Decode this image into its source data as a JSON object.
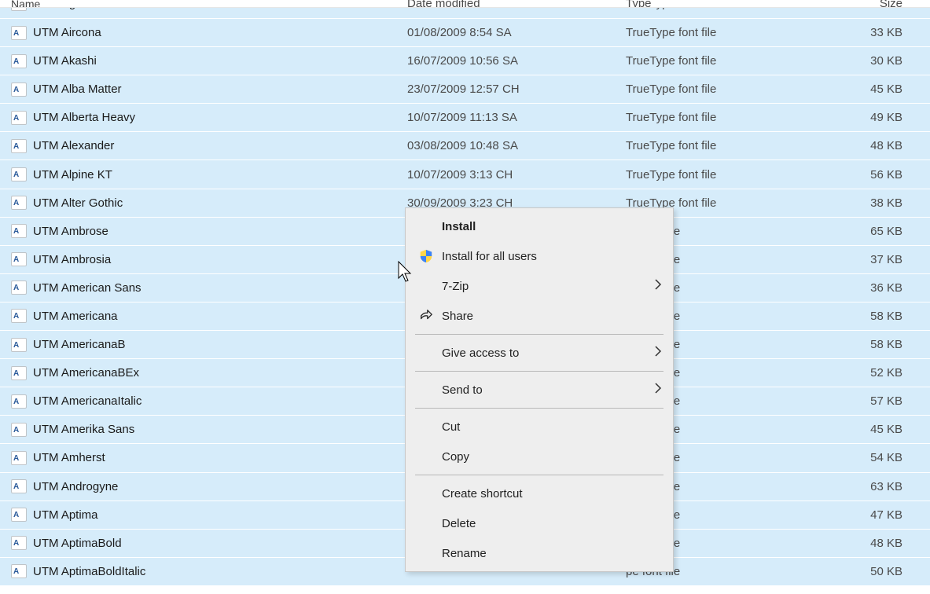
{
  "columns": {
    "name": "Name",
    "date": "Date modified",
    "type": "Type",
    "size": "Size"
  },
  "truetype": "TrueType font file",
  "pe_suffix": "pe font file",
  "files": [
    {
      "name": "UTM Agin",
      "date": "",
      "type_full": true,
      "size": ""
    },
    {
      "name": "UTM Aircona",
      "date": "01/08/2009 8:54 SA",
      "type_full": true,
      "size": "33 KB"
    },
    {
      "name": "UTM Akashi",
      "date": "16/07/2009 10:56 SA",
      "type_full": true,
      "size": "30 KB"
    },
    {
      "name": "UTM Alba Matter",
      "date": "23/07/2009 12:57 CH",
      "type_full": true,
      "size": "45 KB"
    },
    {
      "name": "UTM Alberta Heavy",
      "date": "10/07/2009 11:13 SA",
      "type_full": true,
      "size": "49 KB"
    },
    {
      "name": "UTM Alexander",
      "date": "03/08/2009 10:48 SA",
      "type_full": true,
      "size": "48 KB"
    },
    {
      "name": "UTM Alpine KT",
      "date": "10/07/2009 3:13 CH",
      "type_full": true,
      "size": "56 KB"
    },
    {
      "name": "UTM Alter Gothic",
      "date": "30/09/2009 3:23 CH",
      "type_full": true,
      "size": "38 KB",
      "date_cut": true,
      "type_cut": true
    },
    {
      "name": "UTM Ambrose",
      "date": "",
      "type_full": false,
      "size": "65 KB"
    },
    {
      "name": "UTM Ambrosia",
      "date": "",
      "type_full": false,
      "size": "37 KB"
    },
    {
      "name": "UTM American Sans",
      "date": "",
      "type_full": false,
      "size": "36 KB"
    },
    {
      "name": "UTM Americana",
      "date": "",
      "type_full": false,
      "size": "58 KB"
    },
    {
      "name": "UTM AmericanaB",
      "date": "",
      "type_full": false,
      "size": "58 KB"
    },
    {
      "name": "UTM AmericanaBEx",
      "date": "",
      "type_full": false,
      "size": "52 KB"
    },
    {
      "name": "UTM AmericanaItalic",
      "date": "",
      "type_full": false,
      "size": "57 KB"
    },
    {
      "name": "UTM Amerika Sans",
      "date": "",
      "type_full": false,
      "size": "45 KB"
    },
    {
      "name": "UTM Amherst",
      "date": "",
      "type_full": false,
      "size": "54 KB"
    },
    {
      "name": "UTM Androgyne",
      "date": "",
      "type_full": false,
      "size": "63 KB"
    },
    {
      "name": "UTM Aptima",
      "date": "",
      "type_full": false,
      "size": "47 KB"
    },
    {
      "name": "UTM AptimaBold",
      "date": "",
      "type_full": false,
      "size": "48 KB"
    },
    {
      "name": "UTM AptimaBoldItalic",
      "date": "",
      "type_full": false,
      "size": "50 KB"
    }
  ],
  "context_menu": {
    "install": "Install",
    "install_all": "Install for all users",
    "seven_zip": "7-Zip",
    "share": "Share",
    "give_access": "Give access to",
    "send_to": "Send to",
    "cut": "Cut",
    "copy": "Copy",
    "create_shortcut": "Create shortcut",
    "delete": "Delete",
    "rename": "Rename"
  }
}
